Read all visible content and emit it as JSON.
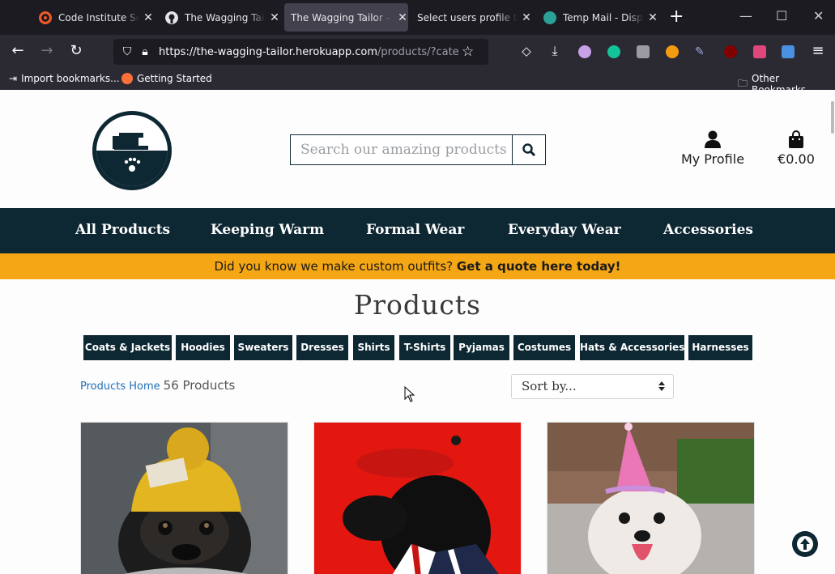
{
  "browser": {
    "tabs": [
      {
        "title": "Code Institute School",
        "favicon_color": "#f05a28"
      },
      {
        "title": "The Wagging Tailor",
        "favicon_color": "#e6e6e9"
      },
      {
        "title": "The Wagging Tailor - Online",
        "favicon_color": "none"
      },
      {
        "title": "Select users profile to ...",
        "favicon_color": "none"
      },
      {
        "title": "Temp Mail - Disposable",
        "favicon_color": "#2aa198"
      }
    ],
    "url_main": "https://the-wagging-tailor.herokuapp.com",
    "url_rest": "/products/?category=",
    "bookmarks": {
      "import": "Import bookmarks...",
      "getting_started": "Getting Started",
      "other": "Other Bookmarks"
    }
  },
  "site": {
    "search_placeholder": "Search our amazing products",
    "profile_label": "My Profile",
    "bag_total": "€0.00",
    "nav": [
      "All Products",
      "Keeping Warm",
      "Formal Wear",
      "Everyday Wear",
      "Accessories"
    ],
    "promo_text": "Did you know we make custom outfits?",
    "promo_link": "Get a quote here today!",
    "page_title": "Products",
    "categories": [
      "Coats & Jackets",
      "Hoodies",
      "Sweaters",
      "Dresses",
      "Shirts",
      "T-Shirts",
      "Pyjamas",
      "Costumes",
      "Hats & Accessories",
      "Harnesses"
    ],
    "breadcrumb_link": "Products Home",
    "product_count": "56 Products",
    "sort_label": "Sort by..."
  },
  "colors": {
    "brand_dark": "#0d2733",
    "promo": "#f4a615",
    "link": "#1e6fb8"
  },
  "icons": {
    "search": "search-icon",
    "profile": "user-icon",
    "bag": "shopping-bag-icon",
    "back_to_top": "arrow-up-icon"
  }
}
